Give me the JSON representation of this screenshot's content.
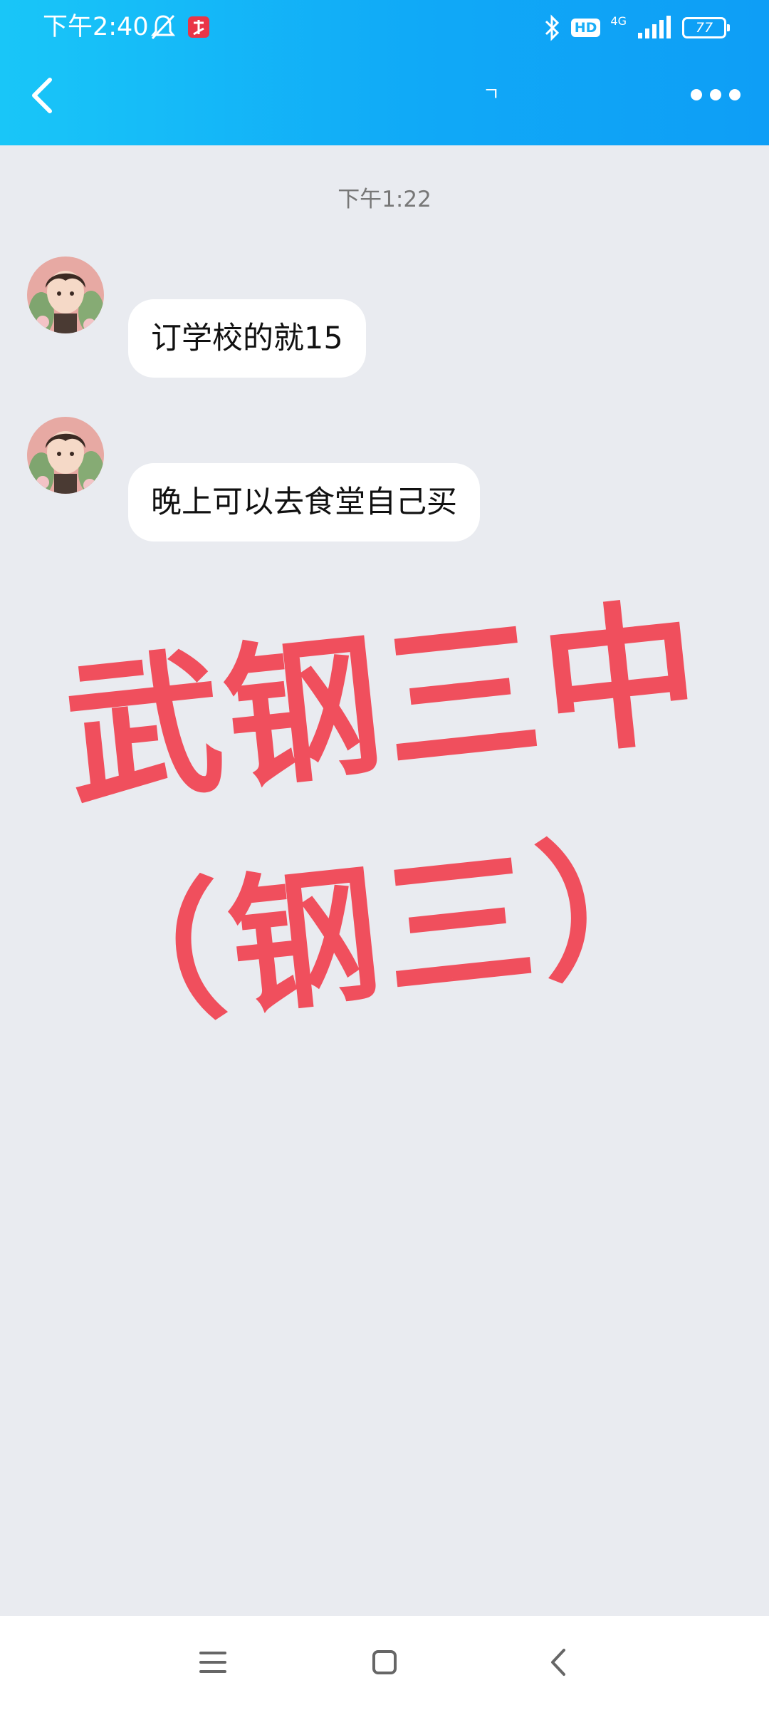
{
  "status_bar": {
    "time": "下午2:40",
    "battery": "77",
    "network": "4G",
    "hd": "HD"
  },
  "header": {
    "title": "ㄱ"
  },
  "chat": {
    "timestamp": "下午1:22",
    "messages": [
      {
        "text": "订学校的就15"
      },
      {
        "text": "晚上可以去食堂自己买"
      }
    ]
  },
  "overlay": {
    "line1": "武钢三中",
    "line2": "（钢三）"
  },
  "colors": {
    "header": "#10a9f7",
    "overlay_text": "#f04f5d",
    "background": "#e9ebf0"
  }
}
